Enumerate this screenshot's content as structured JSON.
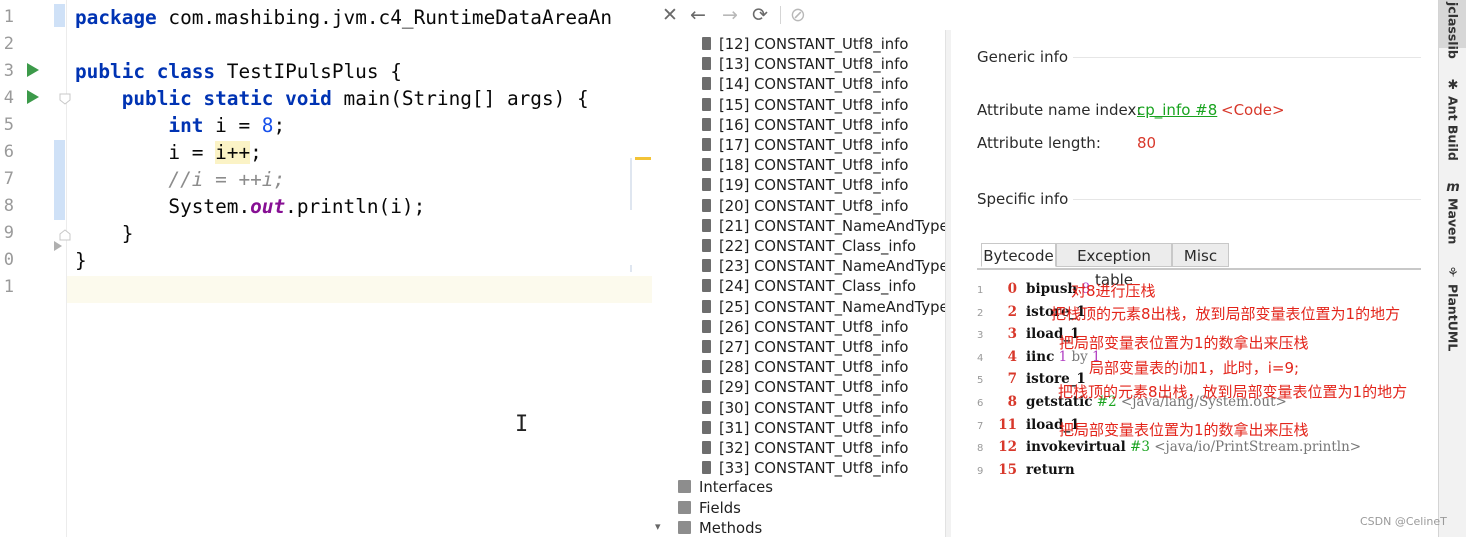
{
  "editor": {
    "line_numbers": [
      "1",
      "2",
      "3",
      "4",
      "5",
      "6",
      "7",
      "8",
      "9",
      "0",
      "1"
    ],
    "lines": [
      [
        {
          "t": "package ",
          "c": "kw"
        },
        {
          "t": "com.mashibing.jvm.c4_RuntimeDataAreaAn",
          "c": ""
        }
      ],
      [],
      [
        {
          "t": "public class ",
          "c": "kw"
        },
        {
          "t": "TestIPulsPlus {",
          "c": ""
        }
      ],
      [
        {
          "t": "    public static void ",
          "c": "kw"
        },
        {
          "t": "main(String[] args) {",
          "c": ""
        }
      ],
      [
        {
          "t": "        int ",
          "c": "kw"
        },
        {
          "t": "i = ",
          "c": ""
        },
        {
          "t": "8",
          "c": "num"
        },
        {
          "t": ";",
          "c": ""
        }
      ],
      [
        {
          "t": "        i = ",
          "c": ""
        },
        {
          "t": "i++",
          "c": "hl"
        },
        {
          "t": ";",
          "c": ""
        }
      ],
      [
        {
          "t": "        //i = ++i;",
          "c": "cmt"
        }
      ],
      [
        {
          "t": "        System.",
          "c": ""
        },
        {
          "t": "out",
          "c": "fld"
        },
        {
          "t": ".println(i);",
          "c": ""
        }
      ],
      [
        {
          "t": "    }",
          "c": ""
        }
      ],
      [
        {
          "t": "}",
          "c": ""
        }
      ],
      []
    ]
  },
  "jclasslib": {
    "toolbar": {
      "close": "✕",
      "back": "←",
      "forward": "→",
      "refresh": "⟳",
      "browser": "⊘"
    },
    "tree": {
      "constants": [
        "[12] CONSTANT_Utf8_info",
        "[13] CONSTANT_Utf8_info",
        "[14] CONSTANT_Utf8_info",
        "[15] CONSTANT_Utf8_info",
        "[16] CONSTANT_Utf8_info",
        "[17] CONSTANT_Utf8_info",
        "[18] CONSTANT_Utf8_info",
        "[19] CONSTANT_Utf8_info",
        "[20] CONSTANT_Utf8_info",
        "[21] CONSTANT_NameAndType_",
        "[22] CONSTANT_Class_info",
        "[23] CONSTANT_NameAndType_",
        "[24] CONSTANT_Class_info",
        "[25] CONSTANT_NameAndType_",
        "[26] CONSTANT_Utf8_info",
        "[27] CONSTANT_Utf8_info",
        "[28] CONSTANT_Utf8_info",
        "[29] CONSTANT_Utf8_info",
        "[30] CONSTANT_Utf8_info",
        "[31] CONSTANT_Utf8_info",
        "[32] CONSTANT_Utf8_info",
        "[33] CONSTANT_Utf8_info"
      ],
      "interfaces": "Interfaces",
      "fields": "Fields",
      "methods": "Methods"
    },
    "detail": {
      "generic_info": "Generic info",
      "attr_name_label": "Attribute name index:",
      "attr_name_link": "cp_info #8",
      "attr_name_value": "<Code>",
      "attr_len_label": "Attribute length:",
      "attr_len_value": "80",
      "specific_info": "Specific info",
      "tabs": [
        "Bytecode",
        "Exception table",
        "Misc"
      ]
    },
    "bytecode": [
      {
        "idx": "1",
        "off": "0",
        "op": "bipush",
        "args": [
          {
            "t": " 8",
            "c": "bc-purple"
          }
        ]
      },
      {
        "idx": "2",
        "off": "2",
        "op": "istore_1",
        "args": []
      },
      {
        "idx": "3",
        "off": "3",
        "op": "iload_1",
        "args": []
      },
      {
        "idx": "4",
        "off": "4",
        "op": "iinc",
        "args": [
          {
            "t": " 1",
            "c": "bc-purple"
          },
          {
            "t": " by ",
            "c": "bc-gray"
          },
          {
            "t": "1",
            "c": "bc-purple"
          }
        ]
      },
      {
        "idx": "5",
        "off": "7",
        "op": "istore_1",
        "args": []
      },
      {
        "idx": "6",
        "off": "8",
        "op": "getstatic",
        "args": [
          {
            "t": " #2",
            "c": "bc-green"
          },
          {
            "t": " <java/lang/System.out>",
            "c": "bc-gray"
          }
        ]
      },
      {
        "idx": "7",
        "off": "11",
        "op": "iload_1",
        "args": []
      },
      {
        "idx": "8",
        "off": "12",
        "op": "invokevirtual",
        "args": [
          {
            "t": " #3",
            "c": "bc-green"
          },
          {
            "t": " <java/io/PrintStream.println>",
            "c": "bc-gray"
          }
        ]
      },
      {
        "idx": "9",
        "off": "15",
        "op": "return",
        "args": []
      }
    ],
    "notes": [
      "对8进行压栈",
      "把栈顶的元素8出栈，放到局部变量表位置为1的地方",
      "把局部变量表位置为1的数拿出来压栈",
      "局部变量表的i加1，此时，i=9;",
      "把栈顶的元素8出栈，放到局部变量表位置为1的地方",
      "把局部变量表位置为1的数拿出来压栈"
    ]
  },
  "tool_strip": {
    "items": [
      {
        "label": "jclasslib",
        "icon": ""
      },
      {
        "label": "Ant Build",
        "icon": "✱"
      },
      {
        "label": "Maven",
        "icon": "m"
      },
      {
        "label": "PlantUML",
        "icon": "⚘"
      }
    ]
  },
  "watermark": "CSDN @CelineT"
}
